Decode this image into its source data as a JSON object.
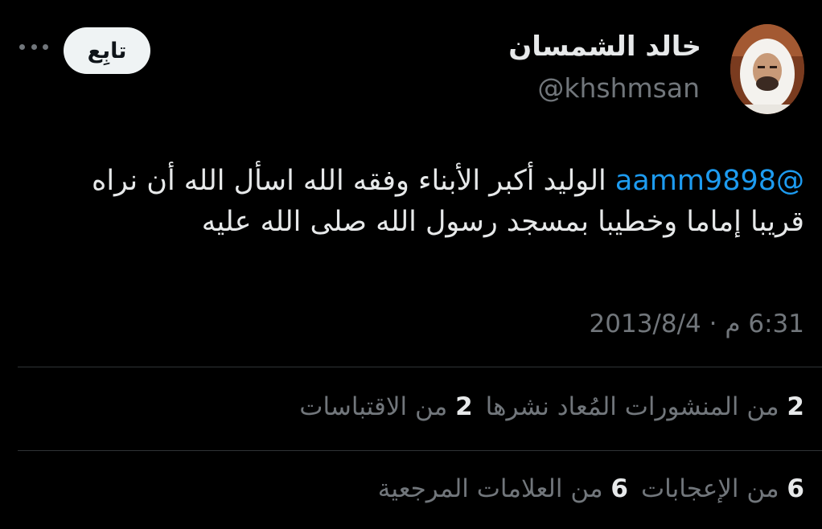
{
  "author": {
    "name": "خالد الشمسان",
    "handle": "@khshmsan"
  },
  "follow_label": "تابِع",
  "tweet": {
    "mention": "@aamm9898",
    "text_after_mention": " الوليد أكبر الأبناء وفقه الله اسأل الله أن نراه قريبا إماما وخطيبا بمسجد رسول الله صلى الله عليه"
  },
  "timestamp": "6:31 م · 2013/8/4",
  "stats": {
    "reposts_count": "2",
    "reposts_label": "من المنشورات المُعاد نشرها",
    "quotes_count": "2",
    "quotes_label": "من الاقتباسات",
    "likes_count": "6",
    "likes_label": "من الإعجابات",
    "bookmarks_count": "6",
    "bookmarks_label": "من العلامات المرجعية"
  },
  "icons": {
    "more": "more-horizontal-icon",
    "avatar": "profile-photo"
  },
  "colors": {
    "background": "#000000",
    "text": "#e7e9ea",
    "muted": "#71767b",
    "link": "#1d9bf0",
    "button_bg": "#eff3f4",
    "divider": "#2f3336"
  }
}
